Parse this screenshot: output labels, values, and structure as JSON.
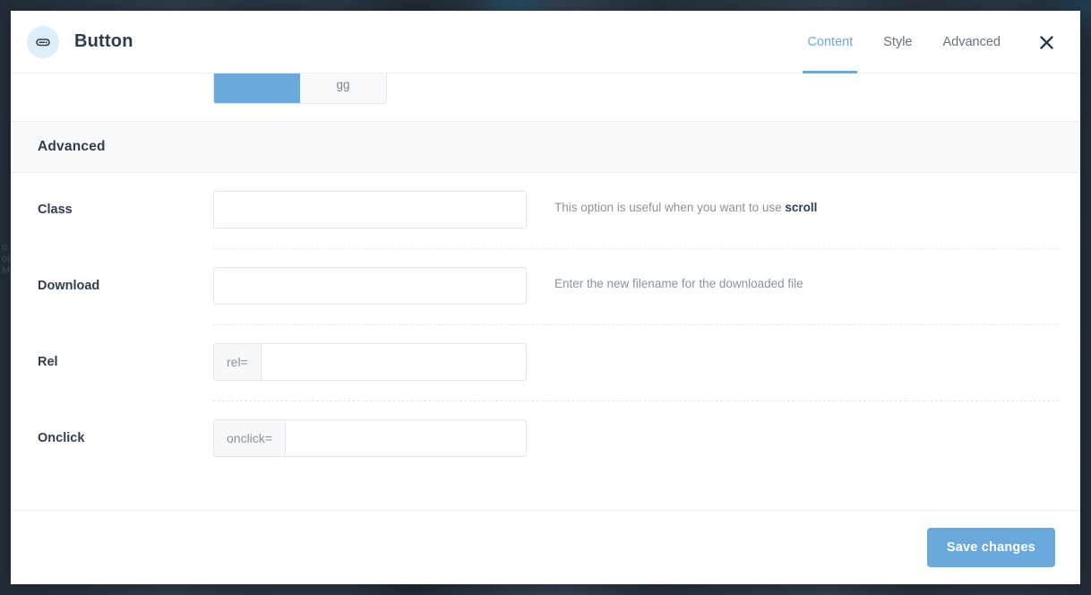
{
  "backdrop": {
    "line1": "o",
    "line2": "o)",
    "line3": "M"
  },
  "header": {
    "title": "Button",
    "icon": "button-widget-icon",
    "tabs": [
      {
        "label": "Content",
        "active": true
      },
      {
        "label": "Style",
        "active": false
      },
      {
        "label": "Advanced",
        "active": false
      }
    ],
    "close_icon": "close-icon"
  },
  "clipped_control": {
    "options": [
      {
        "label": "",
        "active": true
      },
      {
        "label": "gg",
        "active": false
      }
    ]
  },
  "section": {
    "title": "Advanced"
  },
  "fields": [
    {
      "label": "Class",
      "type": "text",
      "value": "",
      "placeholder": "",
      "help_prefix": "This option is useful when you want to use ",
      "help_strong": "scroll"
    },
    {
      "label": "Download",
      "type": "text",
      "value": "",
      "placeholder": "",
      "help_prefix": "Enter the new filename for the downloaded file",
      "help_strong": ""
    },
    {
      "label": "Rel",
      "type": "addon",
      "addon": "rel=",
      "value": "",
      "placeholder": "",
      "help_prefix": "",
      "help_strong": ""
    },
    {
      "label": "Onclick",
      "type": "addon",
      "addon": "onclick=",
      "value": "",
      "placeholder": "",
      "help_prefix": "",
      "help_strong": ""
    }
  ],
  "footer": {
    "save_label": "Save changes"
  },
  "colors": {
    "accent": "#6aa9dd",
    "text_dark": "#323e4e",
    "text_muted": "#8a939d",
    "backdrop": "#2b3643",
    "band": "#f8f9fa"
  }
}
